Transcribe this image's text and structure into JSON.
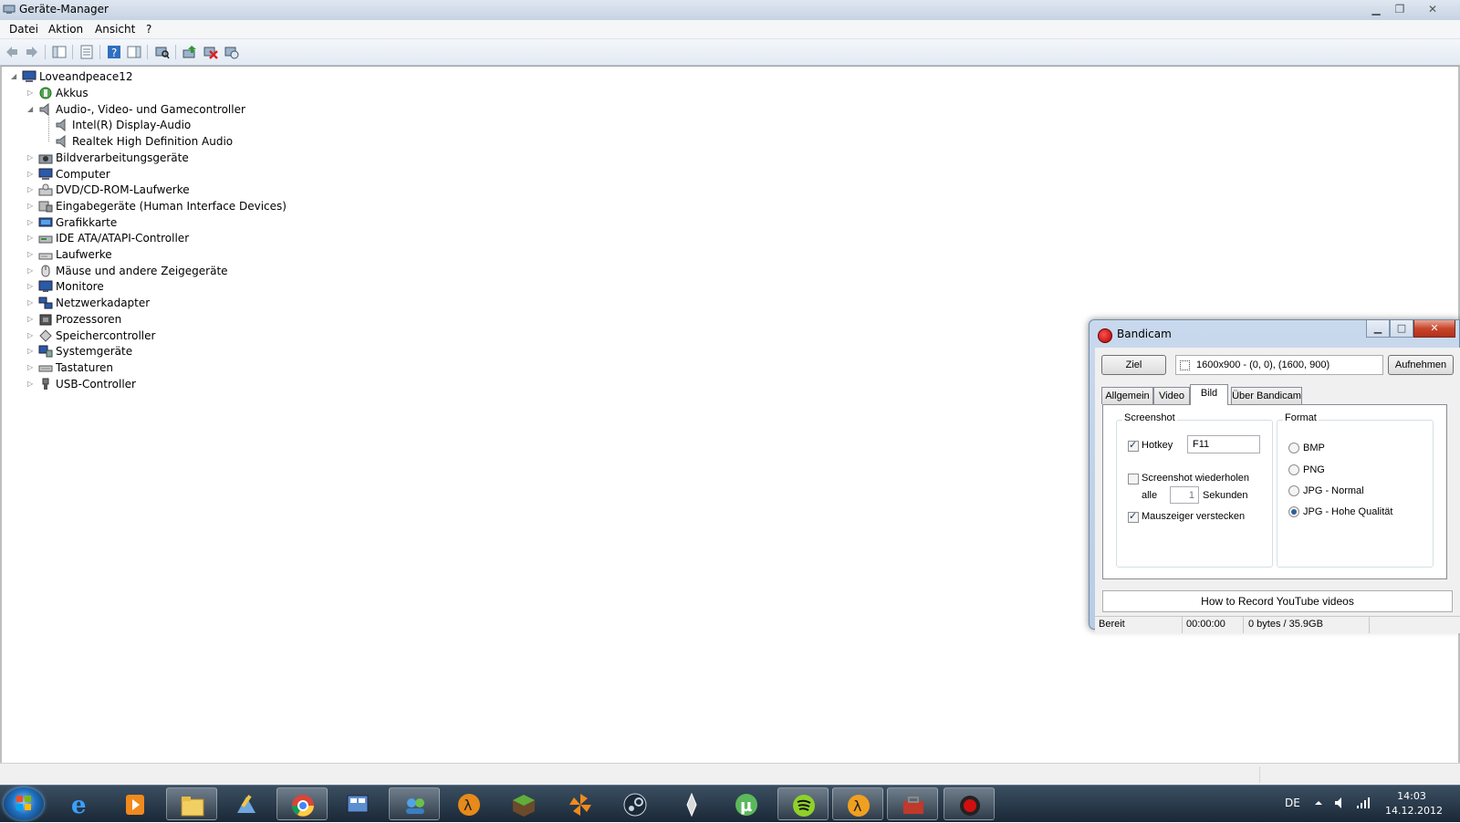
{
  "window": {
    "title": "Geräte-Manager",
    "menu": [
      "Datei",
      "Aktion",
      "Ansicht",
      "?"
    ]
  },
  "tree": {
    "root": "Loveandpeace12",
    "items": [
      {
        "label": "Akkus",
        "icon": "battery-icon",
        "level": 1,
        "expander": "collapsed"
      },
      {
        "label": "Audio-, Video- und Gamecontroller",
        "icon": "speaker-icon",
        "level": 1,
        "expander": "expanded"
      },
      {
        "label": "Intel(R) Display-Audio",
        "icon": "speaker-icon",
        "level": 2,
        "expander": "none"
      },
      {
        "label": "Realtek High Definition Audio",
        "icon": "speaker-icon",
        "level": 2,
        "expander": "none"
      },
      {
        "label": "Bildverarbeitungsgeräte",
        "icon": "camera-icon",
        "level": 1,
        "expander": "collapsed"
      },
      {
        "label": "Computer",
        "icon": "computer-icon",
        "level": 1,
        "expander": "collapsed"
      },
      {
        "label": "DVD/CD-ROM-Laufwerke",
        "icon": "disc-drive-icon",
        "level": 1,
        "expander": "collapsed"
      },
      {
        "label": "Eingabegeräte (Human Interface Devices)",
        "icon": "hid-icon",
        "level": 1,
        "expander": "collapsed"
      },
      {
        "label": "Grafikkarte",
        "icon": "display-adapter-icon",
        "level": 1,
        "expander": "collapsed"
      },
      {
        "label": "IDE ATA/ATAPI-Controller",
        "icon": "ide-controller-icon",
        "level": 1,
        "expander": "collapsed"
      },
      {
        "label": "Laufwerke",
        "icon": "disk-drive-icon",
        "level": 1,
        "expander": "collapsed"
      },
      {
        "label": "Mäuse und andere Zeigegeräte",
        "icon": "mouse-icon",
        "level": 1,
        "expander": "collapsed"
      },
      {
        "label": "Monitore",
        "icon": "monitor-icon",
        "level": 1,
        "expander": "collapsed"
      },
      {
        "label": "Netzwerkadapter",
        "icon": "network-adapter-icon",
        "level": 1,
        "expander": "collapsed"
      },
      {
        "label": "Prozessoren",
        "icon": "processor-icon",
        "level": 1,
        "expander": "collapsed"
      },
      {
        "label": "Speichercontroller",
        "icon": "storage-controller-icon",
        "level": 1,
        "expander": "collapsed"
      },
      {
        "label": "Systemgeräte",
        "icon": "system-device-icon",
        "level": 1,
        "expander": "collapsed"
      },
      {
        "label": "Tastaturen",
        "icon": "keyboard-icon",
        "level": 1,
        "expander": "collapsed"
      },
      {
        "label": "USB-Controller",
        "icon": "usb-icon",
        "level": 1,
        "expander": "collapsed"
      }
    ]
  },
  "bandicam": {
    "title": "Bandicam",
    "target_button": "Ziel",
    "area_text": "1600x900 - (0, 0), (1600, 900)",
    "record_button": "Aufnehmen",
    "tabs": [
      "Allgemein",
      "Video",
      "Bild",
      "Über Bandicam"
    ],
    "active_tab": "Bild",
    "screenshot_group": {
      "label": "Screenshot",
      "hotkey_label": "Hotkey",
      "hotkey_checked": true,
      "hotkey_value": "F11",
      "repeat_label": "Screenshot wiederholen",
      "repeat_checked": false,
      "every_label": "alle",
      "every_value": "1",
      "seconds_label": "Sekunden",
      "hide_cursor_label": "Mauszeiger verstecken",
      "hide_cursor_checked": true
    },
    "format_group": {
      "label": "Format",
      "options": [
        "BMP",
        "PNG",
        "JPG - Normal",
        "JPG - Hohe Qualität"
      ],
      "selected": "JPG - Hohe Qualität"
    },
    "link_text": "How to Record YouTube videos",
    "status": {
      "state": "Bereit",
      "time": "00:00:00",
      "size": "0 bytes / 35.9GB"
    }
  },
  "taskbar": {
    "apps": [
      "internet-explorer-icon",
      "media-player-icon",
      "file-explorer-icon",
      "paint-icon",
      "chrome-icon",
      "control-panel-icon",
      "messenger-icon",
      "half-life-2-icon",
      "minecraft-icon",
      "pinwheel-icon",
      "steam-icon",
      "skyrim-icon",
      "utorrent-icon",
      "spotify-icon",
      "half-life-icon",
      "toolbox-icon",
      "bandicam-icon"
    ],
    "language": "DE",
    "time": "14:03",
    "date": "14.12.2012"
  },
  "colors": {
    "accent": "#1f6fbf",
    "titlebar": "#c6d3e3",
    "record_red": "#c00000"
  }
}
